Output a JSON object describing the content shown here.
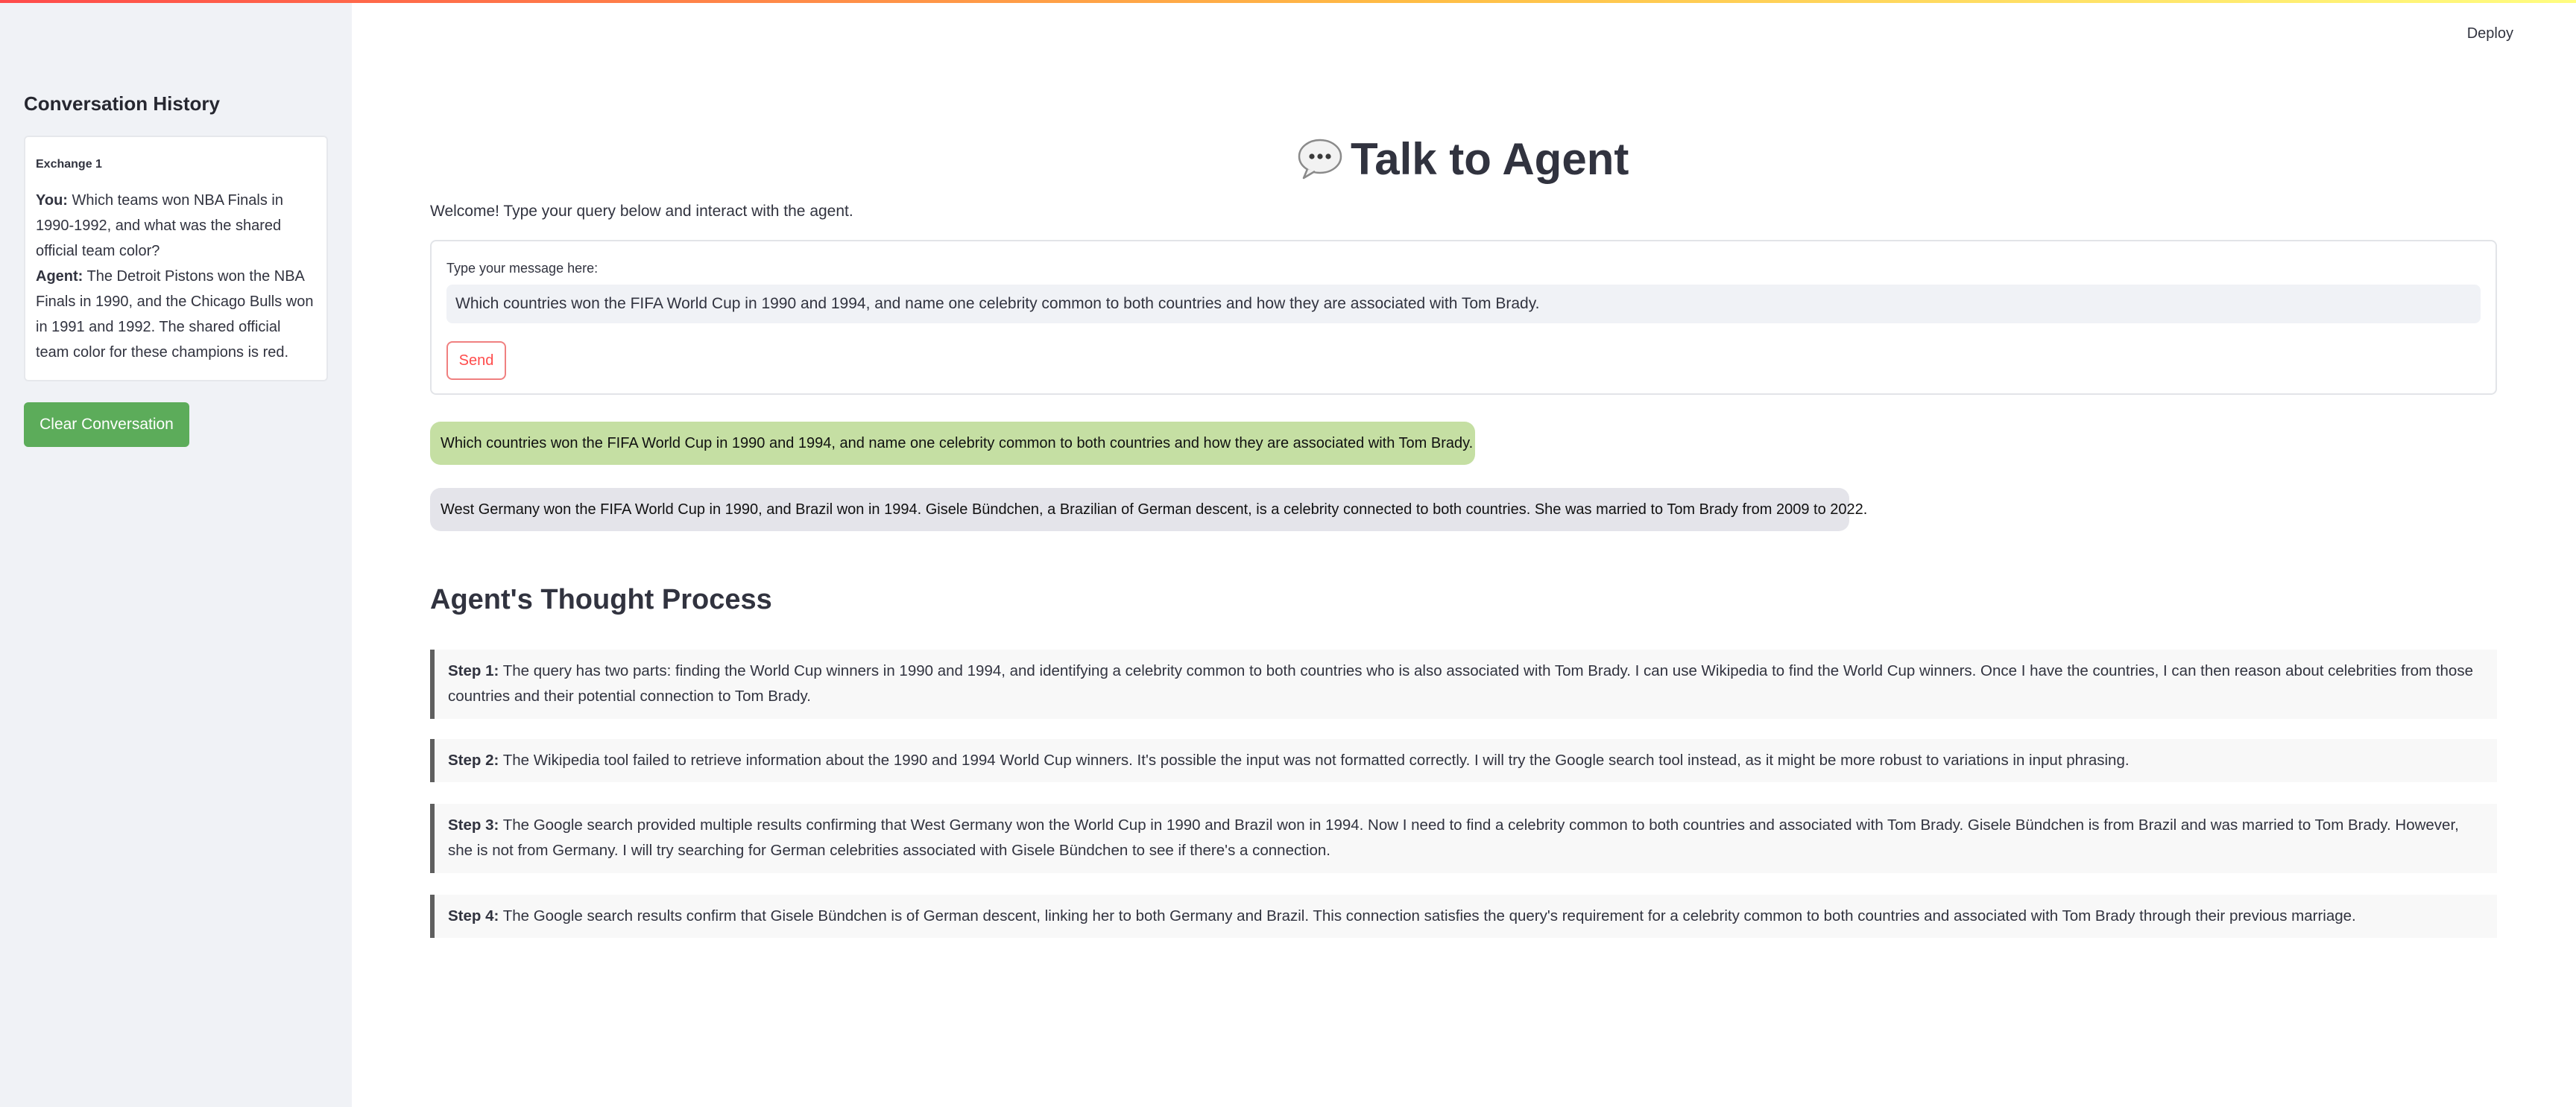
{
  "app": {
    "deploy_label": "Deploy",
    "title": "Talk to Agent",
    "welcome": "Welcome! Type your query below and interact with the agent."
  },
  "sidebar": {
    "title": "Conversation History",
    "exchange_title": "Exchange 1",
    "you_label": "You:",
    "you_text": "Which teams won NBA Finals in 1990-1992, and what was the shared official team color?",
    "agent_label": "Agent:",
    "agent_text": "The Detroit Pistons won the NBA Finals in 1990, and the Chicago Bulls won in 1991 and 1992. The shared official team color for these champions is red.",
    "clear_button": "Clear Conversation"
  },
  "form": {
    "label": "Type your message here:",
    "value": "Which countries won the FIFA World Cup in 1990 and 1994, and name one celebrity common to both countries and how they are associated with Tom Brady.",
    "send_label": "Send"
  },
  "chat": {
    "user_message": "Which countries won the FIFA World Cup in 1990 and 1994, and name one celebrity common to both countries and how they are associated with Tom Brady.",
    "agent_message": "West Germany won the FIFA World Cup in 1990, and Brazil won in 1994. Gisele Bündchen, a Brazilian of German descent, is a celebrity connected to both countries. She was married to Tom Brady from 2009 to 2022."
  },
  "thought": {
    "heading": "Agent's Thought Process",
    "steps": [
      {
        "label": "Step 1:",
        "text": "The query has two parts: finding the World Cup winners in 1990 and 1994, and identifying a celebrity common to both countries who is also associated with Tom Brady. I can use Wikipedia to find the World Cup winners. Once I have the countries, I can then reason about celebrities from those countries and their potential connection to Tom Brady."
      },
      {
        "label": "Step 2:",
        "text": "The Wikipedia tool failed to retrieve information about the 1990 and 1994 World Cup winners. It's possible the input was not formatted correctly. I will try the Google search tool instead, as it might be more robust to variations in input phrasing."
      },
      {
        "label": "Step 3:",
        "text": "The Google search provided multiple results confirming that West Germany won the World Cup in 1990 and Brazil won in 1994. Now I need to find a celebrity common to both countries and associated with Tom Brady. Gisele Bündchen is from Brazil and was married to Tom Brady. However, she is not from Germany. I will try searching for German celebrities associated with Gisele Bündchen to see if there's a connection."
      },
      {
        "label": "Step 4:",
        "text": "The Google search results confirm that Gisele Bündchen is of German descent, linking her to both Germany and Brazil. This connection satisfies the query's requirement for a celebrity common to both countries and associated with Tom Brady through their previous marriage."
      }
    ]
  },
  "icons": {
    "title_icon": "speech-balloon-icon"
  },
  "colors": {
    "accent": "#ff4b4b",
    "clear_button": "#5cac5a",
    "user_bubble": "#c5dfa3",
    "agent_bubble": "#e4e4ea",
    "sidebar_bg": "#f0f2f6"
  }
}
